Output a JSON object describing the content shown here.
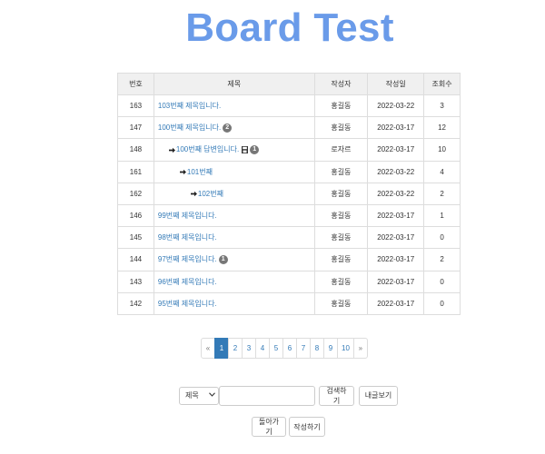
{
  "page": {
    "title": "Board Test"
  },
  "table": {
    "headers": {
      "no": "번호",
      "subject": "제목",
      "writer": "작성자",
      "date": "작성일",
      "views": "조회수"
    },
    "rows": [
      {
        "no": "163",
        "depth": 0,
        "subject": "103번째 제목입니다.",
        "badge": "",
        "attachment": false,
        "writer": "홍길동",
        "date": "2022-03-22",
        "views": "3"
      },
      {
        "no": "147",
        "depth": 0,
        "subject": "100번째 제목입니다.",
        "badge": "2",
        "attachment": false,
        "writer": "홍길동",
        "date": "2022-03-17",
        "views": "12"
      },
      {
        "no": "148",
        "depth": 1,
        "subject": "100번째 답변입니다.",
        "badge": "1",
        "attachment": true,
        "writer": "로자르",
        "date": "2022-03-17",
        "views": "10"
      },
      {
        "no": "161",
        "depth": 2,
        "subject": "101번째",
        "badge": "",
        "attachment": false,
        "writer": "홍길동",
        "date": "2022-03-22",
        "views": "4"
      },
      {
        "no": "162",
        "depth": 3,
        "subject": "102번째",
        "badge": "",
        "attachment": false,
        "writer": "홍길동",
        "date": "2022-03-22",
        "views": "2"
      },
      {
        "no": "146",
        "depth": 0,
        "subject": "99번째 제목입니다.",
        "badge": "",
        "attachment": false,
        "writer": "홍길동",
        "date": "2022-03-17",
        "views": "1"
      },
      {
        "no": "145",
        "depth": 0,
        "subject": "98번째 제목입니다.",
        "badge": "",
        "attachment": false,
        "writer": "홍길동",
        "date": "2022-03-17",
        "views": "0"
      },
      {
        "no": "144",
        "depth": 0,
        "subject": "97번째 제목입니다.",
        "badge": "1",
        "attachment": false,
        "writer": "홍길동",
        "date": "2022-03-17",
        "views": "2"
      },
      {
        "no": "143",
        "depth": 0,
        "subject": "96번째 제목입니다.",
        "badge": "",
        "attachment": false,
        "writer": "홍길동",
        "date": "2022-03-17",
        "views": "0"
      },
      {
        "no": "142",
        "depth": 0,
        "subject": "95번째 제목입니다.",
        "badge": "",
        "attachment": false,
        "writer": "홍길동",
        "date": "2022-03-17",
        "views": "0"
      }
    ]
  },
  "pagination": {
    "prev": "«",
    "next": "»",
    "pages": [
      "1",
      "2",
      "3",
      "4",
      "5",
      "6",
      "7",
      "8",
      "9",
      "10"
    ],
    "current": "1"
  },
  "search": {
    "select_value": "제목",
    "input_value": "",
    "search_button": "검색하기",
    "my_posts_button": "내글보기"
  },
  "actions": {
    "back_button": "돌아가기",
    "write_button": "작성하기"
  },
  "colors": {
    "title": "#6a9be9",
    "link": "#337ab7",
    "active_page": "#337ab7",
    "badge": "#777777"
  }
}
